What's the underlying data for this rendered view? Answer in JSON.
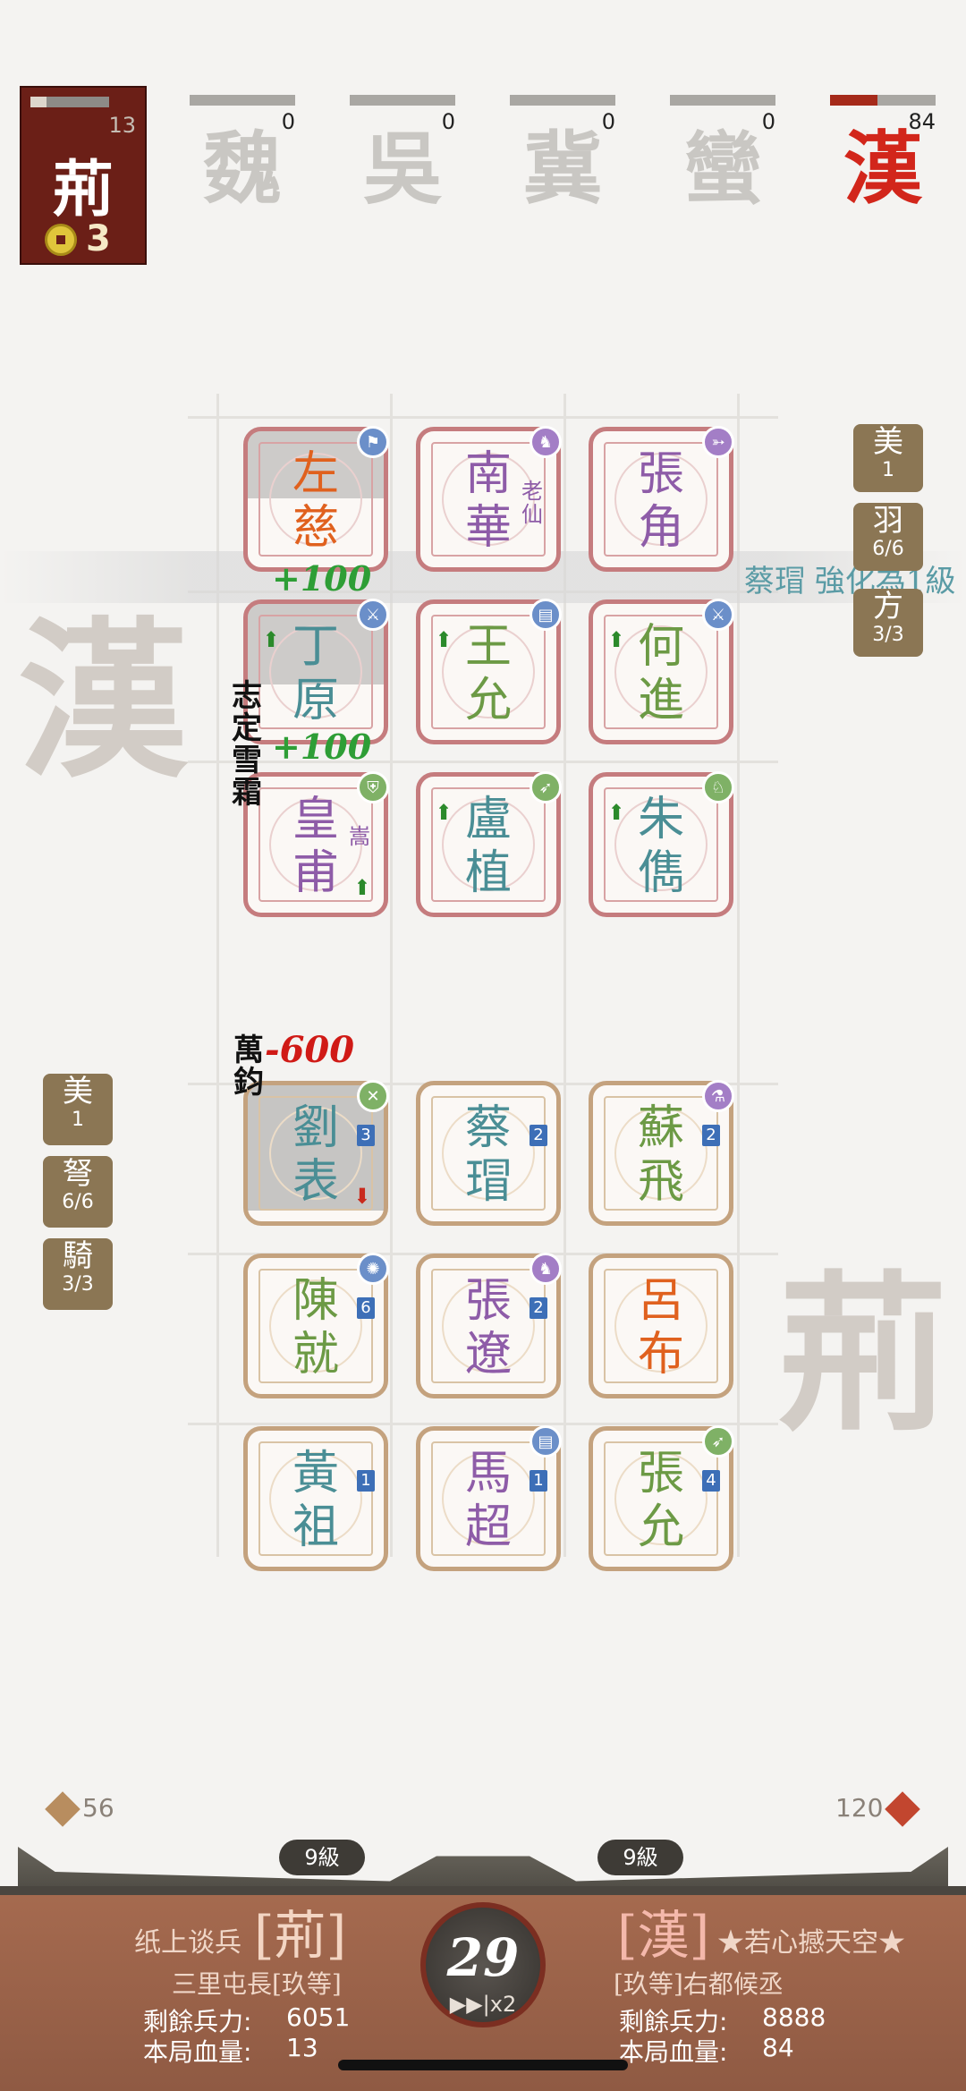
{
  "top": {
    "self": {
      "glyph": "荊",
      "hp": "13",
      "hp_fraction": 0.2,
      "coins": "3"
    },
    "factions": [
      {
        "glyph": "魏",
        "value": "0",
        "fraction": 0
      },
      {
        "glyph": "吳",
        "value": "0",
        "fraction": 0
      },
      {
        "glyph": "冀",
        "value": "0",
        "fraction": 0
      },
      {
        "glyph": "蠻",
        "value": "0",
        "fraction": 0
      },
      {
        "glyph": "漢",
        "value": "84",
        "fraction": 0.45
      }
    ]
  },
  "watermarks": {
    "enemy": "漢",
    "ally": "荊"
  },
  "notice": "蔡瑁 強化為1級",
  "enemy_chips": [
    {
      "t": "美",
      "v": "1"
    },
    {
      "t": "羽",
      "v": "6/6"
    },
    {
      "t": "方",
      "v": "3/3"
    }
  ],
  "ally_chips": [
    {
      "t": "美",
      "v": "1"
    },
    {
      "t": "弩",
      "v": "6/6"
    },
    {
      "t": "騎",
      "v": "3/3"
    }
  ],
  "enemy_units": [
    {
      "n1": "左",
      "n2": "慈",
      "sub": "",
      "color": "orange"
    },
    {
      "n1": "南",
      "n2": "華",
      "sub": "老仙",
      "color": "purple"
    },
    {
      "n1": "張",
      "n2": "角",
      "sub": "",
      "color": "purple"
    },
    {
      "n1": "丁",
      "n2": "原",
      "sub": "",
      "color": "teal"
    },
    {
      "n1": "王",
      "n2": "允",
      "sub": "",
      "color": "green"
    },
    {
      "n1": "何",
      "n2": "進",
      "sub": "",
      "color": "green"
    },
    {
      "n1": "皇",
      "n2": "甫",
      "sub": "嵩",
      "color": "purple"
    },
    {
      "n1": "盧",
      "n2": "植",
      "sub": "",
      "color": "teal"
    },
    {
      "n1": "朱",
      "n2": "儁",
      "sub": "",
      "color": "teal"
    }
  ],
  "ally_units": [
    {
      "n1": "劉",
      "n2": "表",
      "badge": "3",
      "color": "teal"
    },
    {
      "n1": "蔡",
      "n2": "瑁",
      "badge": "2",
      "color": "teal"
    },
    {
      "n1": "蘇",
      "n2": "飛",
      "badge": "2",
      "color": "green"
    },
    {
      "n1": "陳",
      "n2": "就",
      "badge": "6",
      "color": "green"
    },
    {
      "n1": "張",
      "n2": "遼",
      "badge": "2",
      "color": "purple"
    },
    {
      "n1": "呂",
      "n2": "布",
      "badge": "",
      "color": "orange"
    },
    {
      "n1": "黃",
      "n2": "祖",
      "badge": "1",
      "color": "teal"
    },
    {
      "n1": "馬",
      "n2": "超",
      "badge": "1",
      "color": "purple"
    },
    {
      "n1": "張",
      "n2": "允",
      "badge": "4",
      "color": "green"
    }
  ],
  "floats": {
    "heal1": "+100",
    "heal2": "+100",
    "damage": "-600",
    "skill_enemy": "志定雪霜",
    "skill_ally": "萬鈞"
  },
  "resources": {
    "left": "56",
    "right": "120"
  },
  "levels": {
    "left": "9級",
    "right": "9級"
  },
  "player": {
    "name": "纸上谈兵",
    "faction": "[荊]",
    "rank": "三里屯長[玖等]",
    "troops_label": "剩餘兵力:",
    "troops": "6051",
    "hp_label": "本局血量:",
    "hp": "13"
  },
  "opponent": {
    "name": "★若心撼天空★",
    "faction": "[漢]",
    "rank": "[玖等]右都候丞",
    "troops_label": "剩餘兵力:",
    "troops": "8888",
    "hp_label": "本局血量:",
    "hp": "84"
  },
  "timer": {
    "value": "29",
    "speed": "▶▶|x2"
  }
}
